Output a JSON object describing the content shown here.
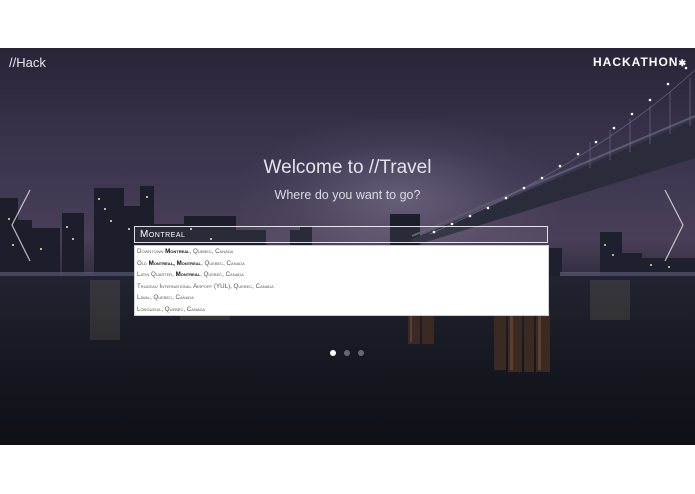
{
  "header": {
    "brand": "//Hack",
    "logo": "HACKATHON"
  },
  "hero": {
    "title": "Welcome to //Travel",
    "subtitle": "Where do you want to go?"
  },
  "search": {
    "value": "Montreal"
  },
  "suggestions": [
    {
      "before": "Downtown ",
      "match": "Montreal",
      "after": ", Quebec, Canada"
    },
    {
      "before": "Old ",
      "match": "Montreal, Montreal",
      "after": ", Quebec, Canada"
    },
    {
      "before": "Latin Quarter, ",
      "match": "Montreal",
      "after": ", Quebec, Canada"
    },
    {
      "before": "Trudeau International Airport (YUL), Quebec, Canada",
      "match": "",
      "after": ""
    },
    {
      "before": "Laval, Quebec, Canada",
      "match": "",
      "after": ""
    },
    {
      "before": "Longueuil, Quebec, Canada",
      "match": "",
      "after": ""
    }
  ],
  "carousel": {
    "slide_count": 3,
    "active_index": 0
  },
  "icons": {
    "prev": "chevron-left-icon",
    "next": "chevron-right-icon",
    "logo_star": "star-icon"
  }
}
